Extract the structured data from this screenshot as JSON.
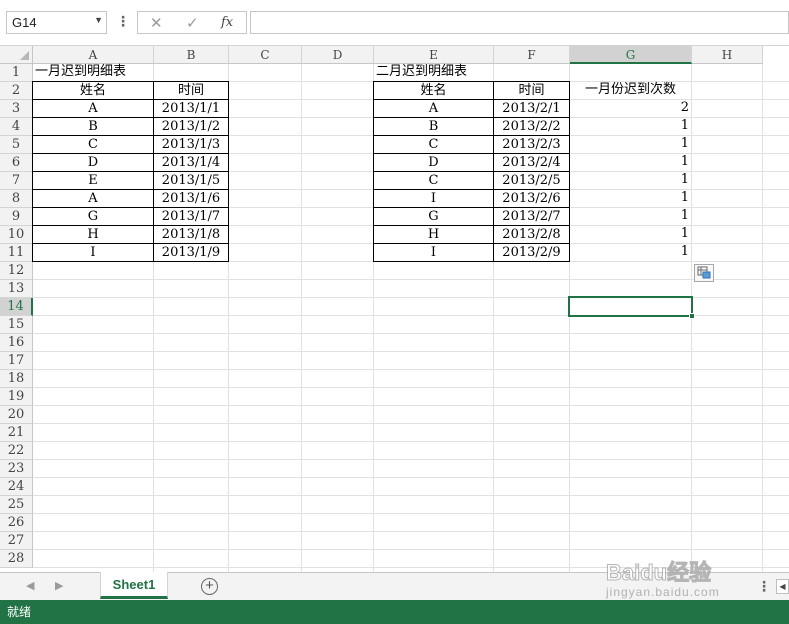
{
  "formula_bar": {
    "name_box": "G14",
    "cancel_icon": "close-icon",
    "enter_icon": "check-icon",
    "fx_label": "fx",
    "formula": ""
  },
  "columns": [
    "A",
    "B",
    "C",
    "D",
    "E",
    "F",
    "G",
    "H"
  ],
  "rows": [
    "1",
    "2",
    "3",
    "4",
    "5",
    "6",
    "7",
    "8",
    "9",
    "10",
    "11",
    "12",
    "13",
    "14",
    "15",
    "16",
    "17",
    "18",
    "19",
    "20",
    "21",
    "22",
    "23",
    "24",
    "25",
    "26",
    "27",
    "28"
  ],
  "selected": {
    "cell": "G14",
    "column": "G",
    "row": "14"
  },
  "january_table": {
    "title": "一月迟到明细表",
    "headers": [
      "姓名",
      "时间"
    ],
    "rows": [
      [
        "A",
        "2013/1/1"
      ],
      [
        "B",
        "2013/1/2"
      ],
      [
        "C",
        "2013/1/3"
      ],
      [
        "D",
        "2013/1/4"
      ],
      [
        "E",
        "2013/1/5"
      ],
      [
        "A",
        "2013/1/6"
      ],
      [
        "G",
        "2013/1/7"
      ],
      [
        "H",
        "2013/1/8"
      ],
      [
        "I",
        "2013/1/9"
      ]
    ]
  },
  "february_table": {
    "title": "二月迟到明细表",
    "headers": [
      "姓名",
      "时间"
    ],
    "rows": [
      [
        "A",
        "2013/2/1"
      ],
      [
        "B",
        "2013/2/2"
      ],
      [
        "C",
        "2013/2/3"
      ],
      [
        "D",
        "2013/2/4"
      ],
      [
        "C",
        "2013/2/5"
      ],
      [
        "I",
        "2013/2/6"
      ],
      [
        "G",
        "2013/2/7"
      ],
      [
        "H",
        "2013/2/8"
      ],
      [
        "I",
        "2013/2/9"
      ]
    ]
  },
  "count_column": {
    "header": "一月份迟到次数",
    "values": [
      "2",
      "1",
      "1",
      "1",
      "1",
      "1",
      "1",
      "1",
      "1"
    ]
  },
  "sheet_tabs": {
    "active": "Sheet1"
  },
  "status_bar": {
    "text": "就绪"
  },
  "watermark": {
    "logo": "Baidu经验",
    "site": "jingyan.baidu.com"
  },
  "colors": {
    "accent": "#217346",
    "header_bg": "#f2f2f2",
    "gridline": "#e1e1e1"
  }
}
